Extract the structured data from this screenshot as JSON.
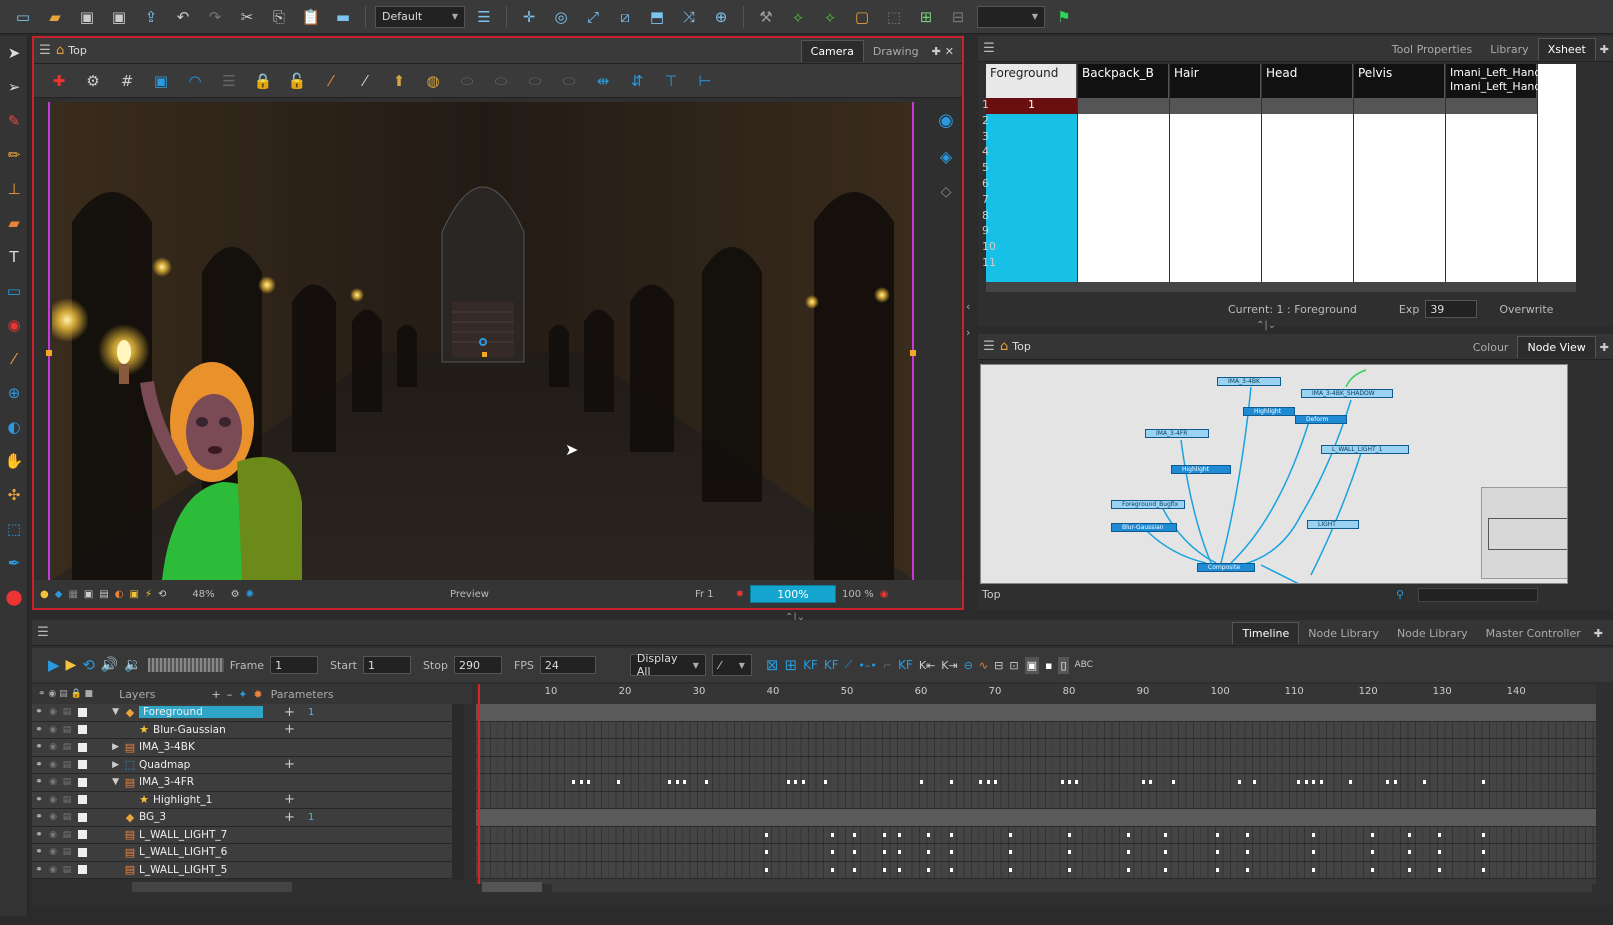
{
  "toolbar": {
    "workspace": "Default",
    "colors": {
      "accent": "#14a6cf",
      "selection": "#c8232c"
    }
  },
  "camera_view": {
    "breadcrumb": "Top",
    "tabs": [
      "Camera",
      "Drawing"
    ],
    "status": {
      "zoom": "48%",
      "preview_label": "Preview",
      "frame_label": "Fr 1",
      "render_progress": "100%",
      "progress_fraction": 1.0,
      "percent_label": "100 %"
    }
  },
  "xsheet": {
    "tabs": [
      "Tool Properties",
      "Library",
      "Xsheet"
    ],
    "columns": [
      "Foreground",
      "Backpack_B",
      "Hair",
      "Head",
      "Pelvis",
      "Imani_Left_Hand Imani_Left_Hand"
    ],
    "rows": [
      "1",
      "2",
      "3",
      "4",
      "5",
      "6",
      "7",
      "8",
      "9",
      "10",
      "11"
    ],
    "first_cell": "1",
    "current": "Current: 1 : Foreground",
    "exp_label": "Exp",
    "exp_value": "39",
    "overwrite": "Overwrite"
  },
  "node_view": {
    "breadcrumb": "Top",
    "tabs": [
      "Colour",
      "Node View"
    ],
    "footer": "Top"
  },
  "timeline": {
    "tabs": [
      "Timeline",
      "Node Library",
      "Node Library",
      "Master Controller"
    ],
    "controls": {
      "frame_label": "Frame",
      "frame_value": "1",
      "start_label": "Start",
      "start_value": "1",
      "stop_label": "Stop",
      "stop_value": "290",
      "fps_label": "FPS",
      "fps_value": "24",
      "display": "Display All"
    },
    "header": {
      "layers": "Layers",
      "parameters": "Parameters"
    },
    "layers": [
      {
        "name": "Foreground",
        "value": "1"
      },
      {
        "name": "Blur-Gaussian",
        "value": ""
      },
      {
        "name": "IMA_3-4BK",
        "value": ""
      },
      {
        "name": "Quadmap",
        "value": ""
      },
      {
        "name": "IMA_3-4FR",
        "value": ""
      },
      {
        "name": "Highlight_1",
        "value": ""
      },
      {
        "name": "BG_3",
        "value": "1"
      },
      {
        "name": "L_WALL_LIGHT_7",
        "value": ""
      },
      {
        "name": "L_WALL_LIGHT_6",
        "value": ""
      },
      {
        "name": "L_WALL_LIGHT_5",
        "value": ""
      }
    ],
    "ruler": [
      "10",
      "20",
      "30",
      "40",
      "50",
      "60",
      "70",
      "80",
      "90",
      "100",
      "110",
      "120",
      "130",
      "140"
    ]
  },
  "nodes": [
    "IMA_3-4BK",
    "IMA_3-4BK_SHADOW",
    "Highlight",
    "Deform",
    "IMA_3-4FR",
    "Highlight",
    "L_WALL_LIGHT_1",
    "Foreground_Bugfix",
    "Blur-Gaussian",
    "LIGHT",
    "Composite"
  ]
}
